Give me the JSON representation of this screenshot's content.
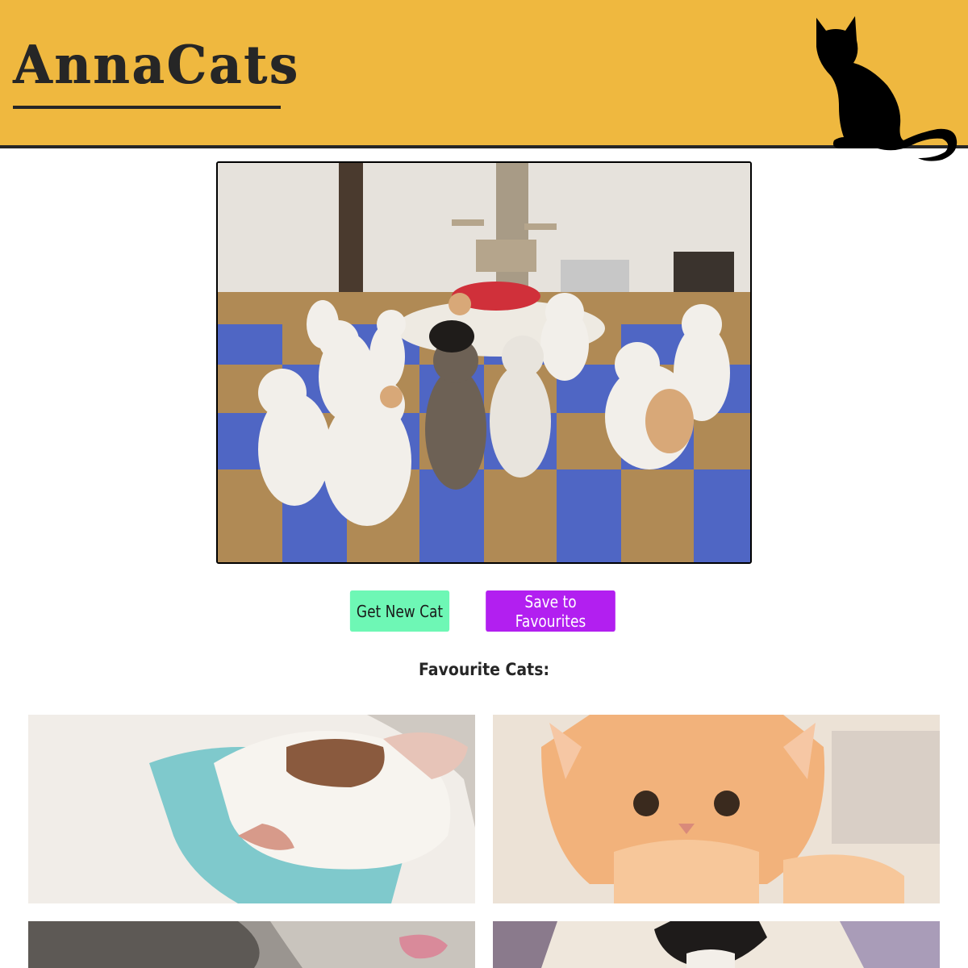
{
  "header": {
    "logo_text": "AnnaCats",
    "background_color": "#efb83f",
    "decoration_icon": "cat-silhouette-icon"
  },
  "hero": {
    "image_icon": "cat-photo"
  },
  "actions": {
    "new_cat_label": "Get New Cat",
    "save_label": "Save to Favourites",
    "new_cat_color": "#6ef7b5",
    "save_color": "#b21ff0"
  },
  "favourites": {
    "title": "Favourite Cats:"
  }
}
